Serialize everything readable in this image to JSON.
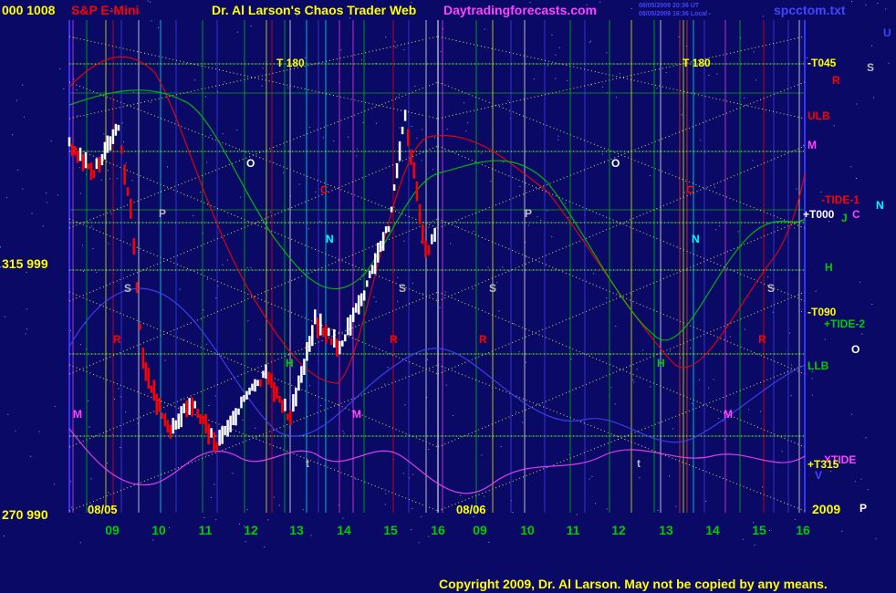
{
  "header": {
    "left_axis_top": "000  1008",
    "symbol": "S&P E-Mini",
    "title": "Dr. Al Larson's Chaos Trader Web",
    "site": "Daytradingforecasts.com",
    "stamp_line1": "08/05/2009 20:36 UT",
    "stamp_line2": "08/05/2009 16:36 Local",
    "file": "spcctom.txt"
  },
  "left_axis": {
    "mid": "315  999",
    "bottom": "270  990"
  },
  "dates": {
    "day1": "08/05",
    "day2": "08/06",
    "year": "2009"
  },
  "x_hours": [
    "09",
    "10",
    "11",
    "12",
    "13",
    "14",
    "15",
    "16",
    "09",
    "10",
    "11",
    "12",
    "13",
    "14",
    "15",
    "16"
  ],
  "markers": {
    "t180": "T  180",
    "o": "O",
    "p": "P",
    "c": "C",
    "n": "N",
    "s": "S",
    "r": "R",
    "m": "M",
    "h": "H",
    "t": "t"
  },
  "right_labels": {
    "u": "U",
    "t045": "-T045",
    "s": "S",
    "r": "R",
    "ulb": "ULB",
    "m": "M",
    "tide1": "-TIDE-1",
    "n": "N",
    "t000": "+T000",
    "j": "J",
    "c": "C",
    "h": "H",
    "t090": "-T090",
    "tide2": "+TIDE-2",
    "o": "O",
    "llb": "LLB",
    "xtide": "XTIDE",
    "t315": "+T315",
    "v": "V",
    "p": "P"
  },
  "footer": {
    "copyright": "Copyright 2009, Dr. Al Larson.  May not be copied by any means."
  },
  "colors": {
    "background": "#0a0a66",
    "white": "#ffffff",
    "yellow": "#ffff00",
    "red": "#ff0000",
    "green": "#00cc00",
    "cyan": "#00ffff",
    "magenta": "#ff44ff",
    "gray": "#bbbbbb",
    "blue": "#4444ff",
    "dotted": "#dddd55"
  },
  "chart_data": {
    "type": "candlestick",
    "instrument": "S&P E-Mini",
    "price_axis_labels": [
      "1008",
      "999",
      "990"
    ],
    "angle_axis_labels": [
      "000",
      "315",
      "270"
    ],
    "ylim": [
      990,
      1008
    ],
    "x_days": [
      "08/05",
      "08/06"
    ],
    "x_hours": [
      "09",
      "10",
      "11",
      "12",
      "13",
      "14",
      "15",
      "16"
    ],
    "price_path": [
      {
        "t": "08/05 08:30",
        "v": 1003.5
      },
      {
        "t": "08/05 09:00",
        "v": 1002.5
      },
      {
        "t": "08/05 09:30",
        "v": 1004.0
      },
      {
        "t": "08/05 09:45",
        "v": 1001.0
      },
      {
        "t": "08/05 10:00",
        "v": 995.5
      },
      {
        "t": "08/05 10:30",
        "v": 993.0
      },
      {
        "t": "08/05 11:00",
        "v": 994.0
      },
      {
        "t": "08/05 11:30",
        "v": 992.5
      },
      {
        "t": "08/05 12:00",
        "v": 994.0
      },
      {
        "t": "08/05 12:30",
        "v": 995.0
      },
      {
        "t": "08/05 13:00",
        "v": 993.5
      },
      {
        "t": "08/05 13:30",
        "v": 997.0
      },
      {
        "t": "08/05 14:00",
        "v": 996.0
      },
      {
        "t": "08/05 14:30",
        "v": 998.0
      },
      {
        "t": "08/05 15:00",
        "v": 1000.5
      },
      {
        "t": "08/05 15:20",
        "v": 1004.5
      },
      {
        "t": "08/05 15:45",
        "v": 999.5
      },
      {
        "t": "08/05 16:00",
        "v": 1000.5
      }
    ]
  }
}
